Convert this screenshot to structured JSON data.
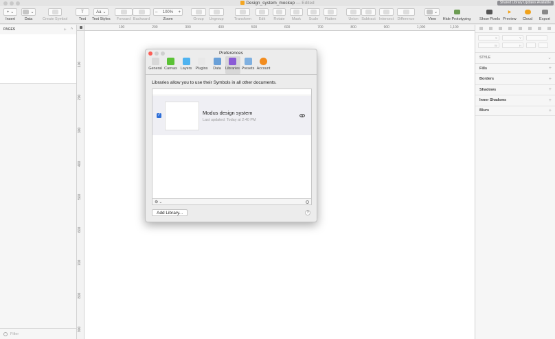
{
  "window": {
    "title": "Design_system_mockup",
    "status": "— Edited",
    "notice": "Shared Library Updates Available"
  },
  "toolbar": {
    "insert": "Insert",
    "data": "Data",
    "create_symbol": "Create Symbol",
    "text": "Text",
    "text_styles": "Text Styles",
    "forward": "Forward",
    "backward": "Backward",
    "zoom": "Zoom",
    "zoom_value": "100%",
    "zoom_minus": "–",
    "zoom_plus": "+",
    "group": "Group",
    "ungroup": "Ungroup",
    "transform": "Transform",
    "edit": "Edit",
    "rotate": "Rotate",
    "mask": "Mask",
    "scale": "Scale",
    "flatten": "Flatten",
    "union": "Union",
    "subtract": "Subtract",
    "intersect": "Intersect",
    "difference": "Difference",
    "view": "View",
    "hide_prototyping": "Hide Prototyping",
    "show_pixels": "Show Pixels",
    "preview": "Preview",
    "cloud": "Cloud",
    "export": "Export",
    "text_icon_glyph": "T",
    "text_styles_glyph": "Aa",
    "insert_glyph": "+"
  },
  "left_panel": {
    "pages_label": "PAGES",
    "filter_placeholder": "Filter"
  },
  "rulers": {
    "x_labels": [
      "100",
      "200",
      "300",
      "400",
      "500",
      "600",
      "700",
      "800",
      "900",
      "1,000",
      "1,100"
    ],
    "y_labels": [
      "100",
      "200",
      "300",
      "400",
      "500",
      "600",
      "700",
      "800",
      "900"
    ]
  },
  "inspector": {
    "field_labels": [
      "X",
      "Y",
      "W",
      "H"
    ],
    "style": "STYLE",
    "fills": "Fills",
    "borders": "Borders",
    "shadows": "Shadows",
    "inner_shadows": "Inner Shadows",
    "blurs": "Blurs"
  },
  "preferences": {
    "title": "Preferences",
    "tabs": [
      {
        "label": "General",
        "icon": "general-icon",
        "color": "#d8d8d8"
      },
      {
        "label": "Canvas",
        "icon": "canvas-icon",
        "color": "#5bc236"
      },
      {
        "label": "Layers",
        "icon": "layers-icon",
        "color": "#4fb3f0"
      },
      {
        "label": "Plugins",
        "icon": "plugins-icon",
        "color": "#e8e8e8"
      },
      {
        "label": "Data",
        "icon": "data-icon",
        "color": "#6aa0d8"
      },
      {
        "label": "Libraries",
        "icon": "libraries-icon",
        "color": "#8a5bd6"
      },
      {
        "label": "Presets",
        "icon": "presets-icon",
        "color": "#7fb0e0"
      },
      {
        "label": "Account",
        "icon": "account-icon",
        "color": "#f28c1e"
      }
    ],
    "active_tab": "Libraries",
    "description": "Libraries allow you to use their Symbols in all other documents.",
    "library": {
      "name": "Modus design system",
      "updated": "Last updated: Today at 2:40 PM",
      "enabled": true
    },
    "add_library": "Add Library...",
    "help": "?"
  }
}
